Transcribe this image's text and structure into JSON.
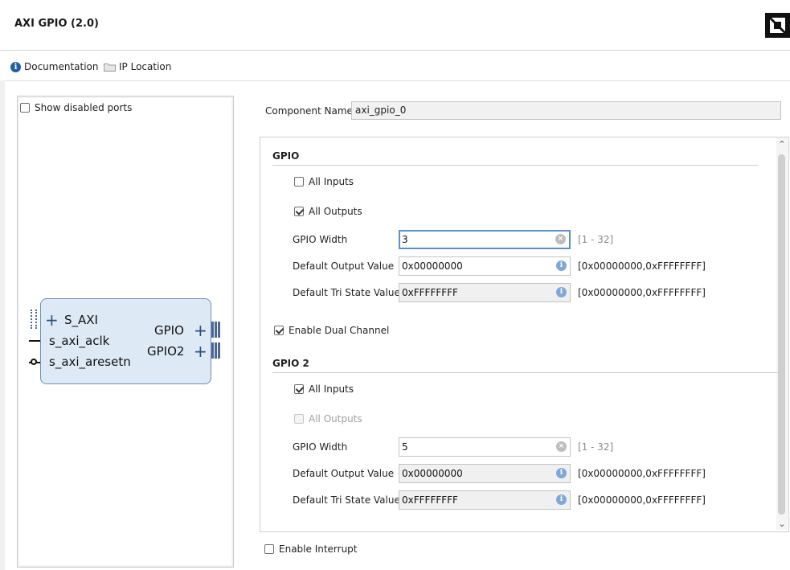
{
  "window": {
    "title": "AXI GPIO (2.0)",
    "logo_icon": "amd-logo-icon"
  },
  "toolbar": {
    "documentation": "Documentation",
    "ip_location": "IP Location"
  },
  "preview": {
    "show_disabled_ports": "Show disabled ports",
    "ports_left": [
      "S_AXI",
      "s_axi_aclk",
      "s_axi_aresetn"
    ],
    "ports_right": [
      "GPIO",
      "GPIO2"
    ]
  },
  "component": {
    "label": "Component Name",
    "value": "axi_gpio_0"
  },
  "gpio": {
    "title": "GPIO",
    "all_inputs": "All Inputs",
    "all_outputs": "All Outputs",
    "width_label": "GPIO Width",
    "width_value": "3",
    "width_range": "[1 - 32]",
    "default_output_label": "Default Output Value",
    "default_output_value": "0x00000000",
    "default_output_range": "[0x00000000,0xFFFFFFFF]",
    "default_tri_label": "Default Tri State Value",
    "default_tri_value": "0xFFFFFFFF",
    "default_tri_range": "[0x00000000,0xFFFFFFFF]"
  },
  "dual_channel": "Enable Dual Channel",
  "gpio2": {
    "title": "GPIO 2",
    "all_inputs": "All Inputs",
    "all_outputs": "All Outputs",
    "width_label": "GPIO Width",
    "width_value": "5",
    "width_range": "[1 - 32]",
    "default_output_label": "Default Output Value",
    "default_output_value": "0x00000000",
    "default_output_range": "[0x00000000,0xFFFFFFFF]",
    "default_tri_label": "Default Tri State Value",
    "default_tri_value": "0xFFFFFFFF",
    "default_tri_range": "[0x00000000,0xFFFFFFFF]"
  },
  "enable_interrupt": "Enable Interrupt",
  "colors": {
    "accent": "#1e5fa8",
    "block_fill": "#dde9f5",
    "focus_border": "#5b8fd3"
  }
}
